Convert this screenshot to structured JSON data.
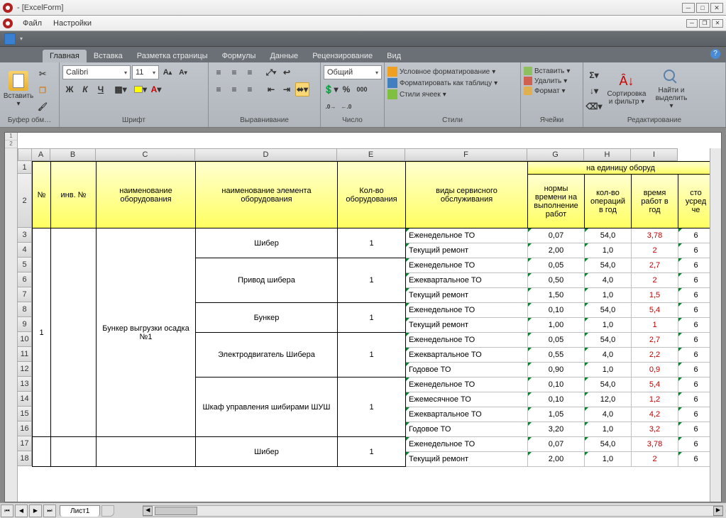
{
  "window": {
    "title": "- [ExcelForm]"
  },
  "menu": {
    "file": "Файл",
    "settings": "Настройки"
  },
  "tabs": {
    "home": "Главная",
    "insert": "Вставка",
    "pagelayout": "Разметка страницы",
    "formulas": "Формулы",
    "data": "Данные",
    "review": "Рецензирование",
    "view": "Вид"
  },
  "ribbon": {
    "clipboard": {
      "paste": "Вставить",
      "label": "Буфер обм…"
    },
    "font": {
      "name": "Calibri",
      "size": "11",
      "label": "Шрифт",
      "bold": "Ж",
      "italic": "К",
      "underline": "Ч"
    },
    "alignment": {
      "label": "Выравнивание"
    },
    "number": {
      "format": "Общий",
      "label": "Число"
    },
    "styles": {
      "condfmt": "Условное форматирование",
      "fmttable": "Форматировать как таблицу",
      "cellstyles": "Стили ячеек",
      "label": "Стили"
    },
    "cells": {
      "insert": "Вставить",
      "delete": "Удалить",
      "format": "Формат",
      "label": "Ячейки"
    },
    "editing": {
      "sort": "Сортировка и фильтр",
      "find": "Найти и выделить",
      "label": "Редактирование"
    }
  },
  "columns": [
    "A",
    "B",
    "C",
    "D",
    "E",
    "F",
    "G",
    "H",
    "I"
  ],
  "rows": [
    "1",
    "2",
    "3",
    "4",
    "5",
    "6",
    "7",
    "8",
    "9",
    "10",
    "11",
    "12",
    "13",
    "14",
    "15",
    "16",
    "17",
    "18"
  ],
  "headers": {
    "span": "на единицу оборуд",
    "A": "№",
    "B": "инв. №",
    "C": "наименование оборудования",
    "D": "наименование элемента оборудования",
    "E": "Кол-во оборудования",
    "F": "виды сервисного обслуживания",
    "G": "нормы времени на выполнение работ",
    "H": "кол-во операций в год",
    "I": "время работ в год",
    "J": "сто усред че"
  },
  "data": {
    "no": "1",
    "equipment": "Бункер выгрузки осадка №1",
    "elements": [
      {
        "name": "Шибер",
        "qty": "1",
        "services": [
          {
            "type": "Еженедельное ТО",
            "g": "0,07",
            "h": "54,0",
            "i": "3,78",
            "j": "6"
          },
          {
            "type": "Текущий ремонт",
            "g": "2,00",
            "h": "1,0",
            "i": "2",
            "j": "6"
          }
        ]
      },
      {
        "name": "Привод шибера",
        "qty": "1",
        "services": [
          {
            "type": "Еженедельное ТО",
            "g": "0,05",
            "h": "54,0",
            "i": "2,7",
            "j": "6"
          },
          {
            "type": "Ежеквартальное ТО",
            "g": "0,50",
            "h": "4,0",
            "i": "2",
            "j": "6"
          },
          {
            "type": "Текущий ремонт",
            "g": "1,50",
            "h": "1,0",
            "i": "1,5",
            "j": "6"
          }
        ]
      },
      {
        "name": "Бункер",
        "qty": "1",
        "services": [
          {
            "type": "Еженедельное ТО",
            "g": "0,10",
            "h": "54,0",
            "i": "5,4",
            "j": "6"
          },
          {
            "type": "Текущий ремонт",
            "g": "1,00",
            "h": "1,0",
            "i": "1",
            "j": "6"
          }
        ]
      },
      {
        "name": "Электродвигатель Шибера",
        "qty": "1",
        "services": [
          {
            "type": "Еженедельное ТО",
            "g": "0,05",
            "h": "54,0",
            "i": "2,7",
            "j": "6"
          },
          {
            "type": "Ежеквартальное ТО",
            "g": "0,55",
            "h": "4,0",
            "i": "2,2",
            "j": "6"
          },
          {
            "type": "Годовое ТО",
            "g": "0,90",
            "h": "1,0",
            "i": "0,9",
            "j": "6"
          }
        ]
      },
      {
        "name": "Шкаф управления шибирами ШУШ",
        "qty": "1",
        "services": [
          {
            "type": "Еженедельное ТО",
            "g": "0,10",
            "h": "54,0",
            "i": "5,4",
            "j": "6"
          },
          {
            "type": "Ежемесячное ТО",
            "g": "0,10",
            "h": "12,0",
            "i": "1,2",
            "j": "6"
          },
          {
            "type": "Ежеквартальное ТО",
            "g": "1,05",
            "h": "4,0",
            "i": "4,2",
            "j": "6"
          },
          {
            "type": "Годовое ТО",
            "g": "3,20",
            "h": "1,0",
            "i": "3,2",
            "j": "6"
          }
        ]
      },
      {
        "name": "Шибер",
        "qty": "1",
        "services": [
          {
            "type": "Еженедельное ТО",
            "g": "0,07",
            "h": "54,0",
            "i": "3,78",
            "j": "6"
          },
          {
            "type": "Текущий ремонт",
            "g": "2,00",
            "h": "1,0",
            "i": "2",
            "j": "6"
          }
        ]
      }
    ]
  },
  "sheet_tab": "Лист1"
}
